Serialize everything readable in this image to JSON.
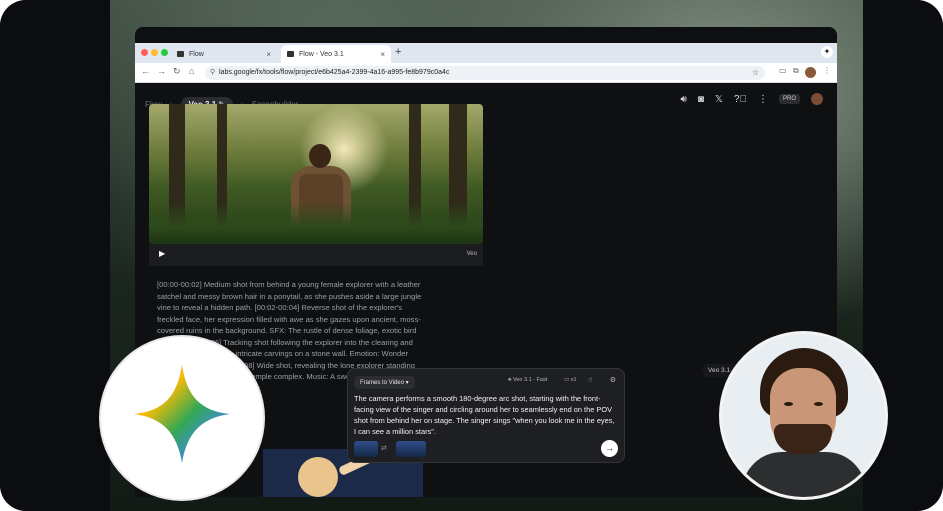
{
  "browser": {
    "tabs": [
      {
        "label": "Flow",
        "active": false
      },
      {
        "label": "Flow - Veo 3.1",
        "active": true
      }
    ],
    "new_tab_icon": "plus-icon",
    "url": "labs.google/fx/tools/flow/project/e6b425a4-2399-4a16-a995-fe8b979c0a4c"
  },
  "app": {
    "breadcrumbs": [
      "Flow",
      "Veo 3.1",
      "Scenebuilder"
    ],
    "top_icons": [
      "volume-icon",
      "discord-icon",
      "x-logo-icon",
      "help-icon",
      "more-icon"
    ],
    "pro_badge": "PRO"
  },
  "video": {
    "watermark": "Veo",
    "prompt": "[00:00-00:02] Medium shot from behind a young female explorer with a leather satchel and messy brown hair in a ponytail, as she pushes aside a large jungle vine to reveal a hidden path. [00:02-00:04] Reverse shot of the explorer's freckled face, her expression filled with awe as she gazes upon ancient, moss-covered ruins in the background. SFX: The rustle of dense foliage, exotic bird calls. [00:04-00:06] Tracking shot following the explorer into the clearing and runs her hand over the intricate carvings on a stone wall. Emotion: Wonder and reverence. [00:06-00:08] Wide shot, revealing the lone explorer standing before a massive forgotten temple complex. Music: A swelling, gentle orchestral score begins to play."
  },
  "quality_label": "Veo 3.1 - Quality",
  "composer": {
    "mode": "Frames to Video",
    "model": "Veo 3.1 - Fast",
    "count": "x1",
    "text": "The camera performs a smooth 180-degree arc shot, starting with the front-facing view of the singer and circling around her to seamlessly end on the POV shot from behind her on stage. The singer sings \"when you look me in the eyes, I can see a million stars\"."
  },
  "colors": {
    "gemini_blue": "#4285f4",
    "gemini_red": "#ea4335",
    "gemini_yellow": "#fbbc04",
    "gemini_green": "#34a853"
  }
}
